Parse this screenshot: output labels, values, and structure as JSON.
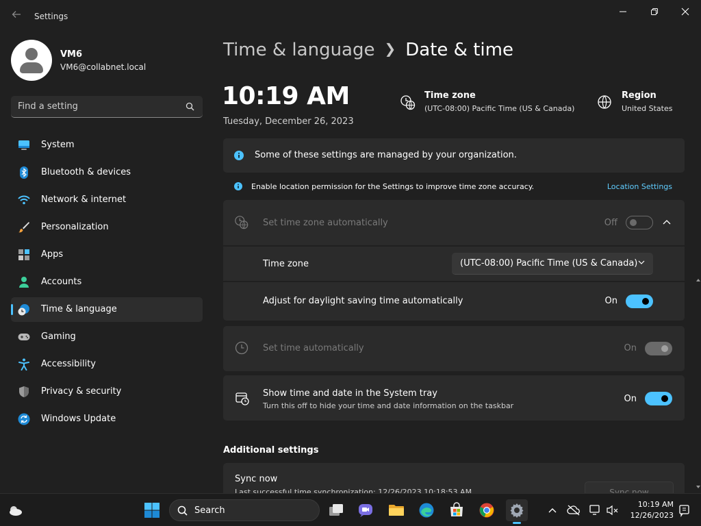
{
  "window": {
    "title": "Settings"
  },
  "user": {
    "name": "VM6",
    "email": "VM6@collabnet.local"
  },
  "search": {
    "placeholder": "Find a setting"
  },
  "nav": {
    "items": [
      {
        "label": "System",
        "icon": "system-icon"
      },
      {
        "label": "Bluetooth & devices",
        "icon": "bluetooth-icon"
      },
      {
        "label": "Network & internet",
        "icon": "wifi-icon"
      },
      {
        "label": "Personalization",
        "icon": "paintbrush-icon"
      },
      {
        "label": "Apps",
        "icon": "apps-icon"
      },
      {
        "label": "Accounts",
        "icon": "accounts-icon"
      },
      {
        "label": "Time & language",
        "icon": "time-language-icon",
        "active": true
      },
      {
        "label": "Gaming",
        "icon": "gamepad-icon"
      },
      {
        "label": "Accessibility",
        "icon": "accessibility-icon"
      },
      {
        "label": "Privacy & security",
        "icon": "shield-icon"
      },
      {
        "label": "Windows Update",
        "icon": "update-icon"
      }
    ]
  },
  "header": {
    "parent": "Time & language",
    "current": "Date & time"
  },
  "clock": {
    "time": "10:19 AM",
    "date": "Tuesday, December 26, 2023"
  },
  "timezone_info": {
    "title": "Time zone",
    "value": "(UTC-08:00) Pacific Time (US & Canada)"
  },
  "region_info": {
    "title": "Region",
    "value": "United States"
  },
  "notice": {
    "text": "Some of these settings are managed by your organization."
  },
  "location_tip": {
    "text": "Enable location permission for the Settings to improve time zone accuracy.",
    "link": "Location Settings"
  },
  "settings": {
    "auto_timezone": {
      "label": "Set time zone automatically",
      "state": "Off"
    },
    "timezone": {
      "label": "Time zone",
      "value": "(UTC-08:00) Pacific Time (US & Canada)"
    },
    "daylight": {
      "label": "Adjust for daylight saving time automatically",
      "state": "On"
    },
    "auto_time": {
      "label": "Set time automatically",
      "state": "On"
    },
    "tray": {
      "label": "Show time and date in the System tray",
      "sub": "Turn this off to hide your time and date information on the taskbar",
      "state": "On"
    }
  },
  "additional": {
    "title": "Additional settings",
    "sync_title": "Sync now",
    "sync_sub": "Last successful time synchronization: 12/26/2023 10:18:53 AM",
    "sync_button": "Sync now"
  },
  "taskbar": {
    "search_label": "Search",
    "time": "10:19 AM",
    "date": "12/26/2023"
  },
  "colors": {
    "accent": "#4cc2ff",
    "link": "#60cdff",
    "background": "#202020",
    "card": "#2b2b2b"
  }
}
